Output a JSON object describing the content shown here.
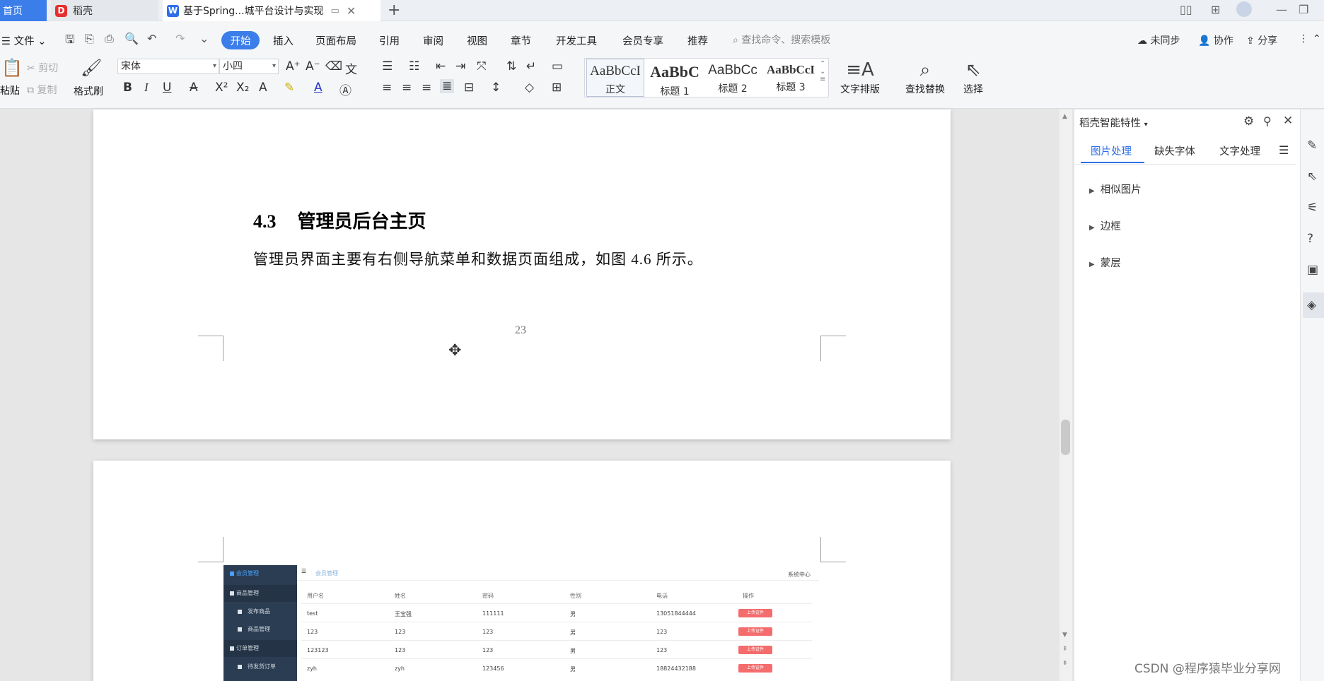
{
  "tabs": {
    "home": "首页",
    "daoke": "稻壳",
    "doc": "基于Spring...城平台设计与实现"
  },
  "menu": {
    "file": "文件",
    "items": [
      "开始",
      "插入",
      "页面布局",
      "引用",
      "审阅",
      "视图",
      "章节",
      "开发工具",
      "会员专享",
      "推荐"
    ],
    "search_placeholder": "查找命令、搜索模板",
    "sync": "未同步",
    "collab": "协作",
    "share": "分享"
  },
  "ribbon": {
    "paste": "粘贴",
    "cut": "剪切",
    "copy": "复制",
    "format_painter": "格式刷",
    "font": "宋体",
    "size": "小四",
    "styles": [
      {
        "preview": "AaBbCcI",
        "label": "正文"
      },
      {
        "preview": "AaBbC",
        "label": "标题 1"
      },
      {
        "preview": "AaBbCc",
        "label": "标题 2"
      },
      {
        "preview": "AaBbCcI",
        "label": "标题 3"
      }
    ],
    "text_layout": "文字排版",
    "find_replace": "查找替换",
    "select": "选择"
  },
  "document": {
    "heading_num": "4.3",
    "heading_text": "管理员后台主页",
    "body": "管理员界面主要有右侧导航菜单和数据页面组成，如图 4.6 所示。",
    "page_number": "23"
  },
  "screenshot": {
    "side": [
      "会员管理",
      "商品管理",
      "发布商品",
      "商品管理",
      "订单管理",
      "待发货订单"
    ],
    "crumb": "会员管理",
    "top_right": "系统中心",
    "headers": [
      "用户名",
      "姓名",
      "密码",
      "性别",
      "电话",
      "操作"
    ],
    "rows": [
      [
        "test",
        "王宝强",
        "111111",
        "男",
        "13051844444"
      ],
      [
        "123",
        "123",
        "123",
        "男",
        "123"
      ],
      [
        "123123",
        "123",
        "123",
        "男",
        "123"
      ],
      [
        "zyh",
        "zyh",
        "123456",
        "男",
        "18824432188"
      ]
    ],
    "action": "上传证件"
  },
  "panel": {
    "title": "稻壳智能特性",
    "tabs": [
      "图片处理",
      "缺失字体",
      "文字处理"
    ],
    "items": [
      "相似图片",
      "边框",
      "蒙层"
    ]
  },
  "watermark": "CSDN @程序猿毕业分享网",
  "colors": {
    "accent": "#3b7de9",
    "sidebar_dark": "#2b3d52",
    "danger": "#f56c6c"
  }
}
